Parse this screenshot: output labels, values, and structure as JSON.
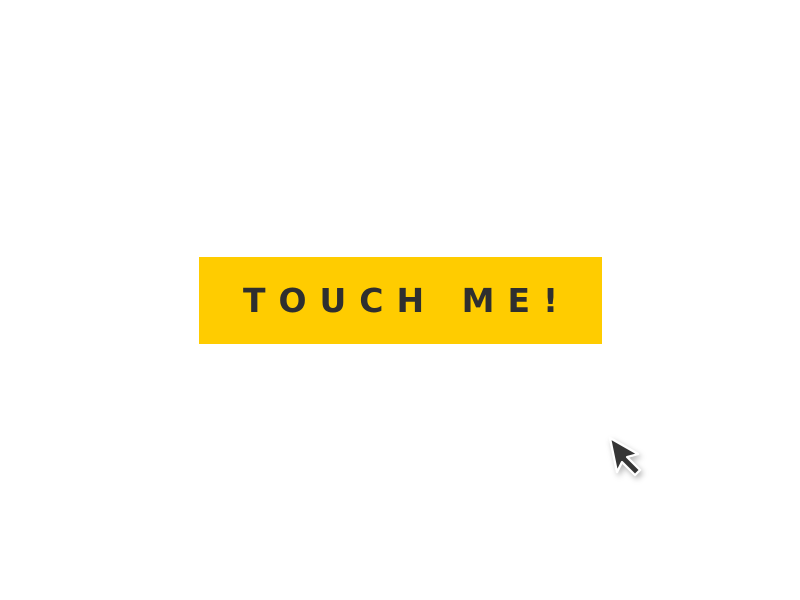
{
  "button": {
    "label": "TOUCH ME!"
  },
  "cursor": {
    "icon": "arrow-pointer-icon"
  },
  "colors": {
    "background": "#ffffff",
    "button_background": "#ffcc00",
    "button_text": "#2f2f2f",
    "cursor_fill": "#353535",
    "cursor_outline": "#ffffff"
  }
}
